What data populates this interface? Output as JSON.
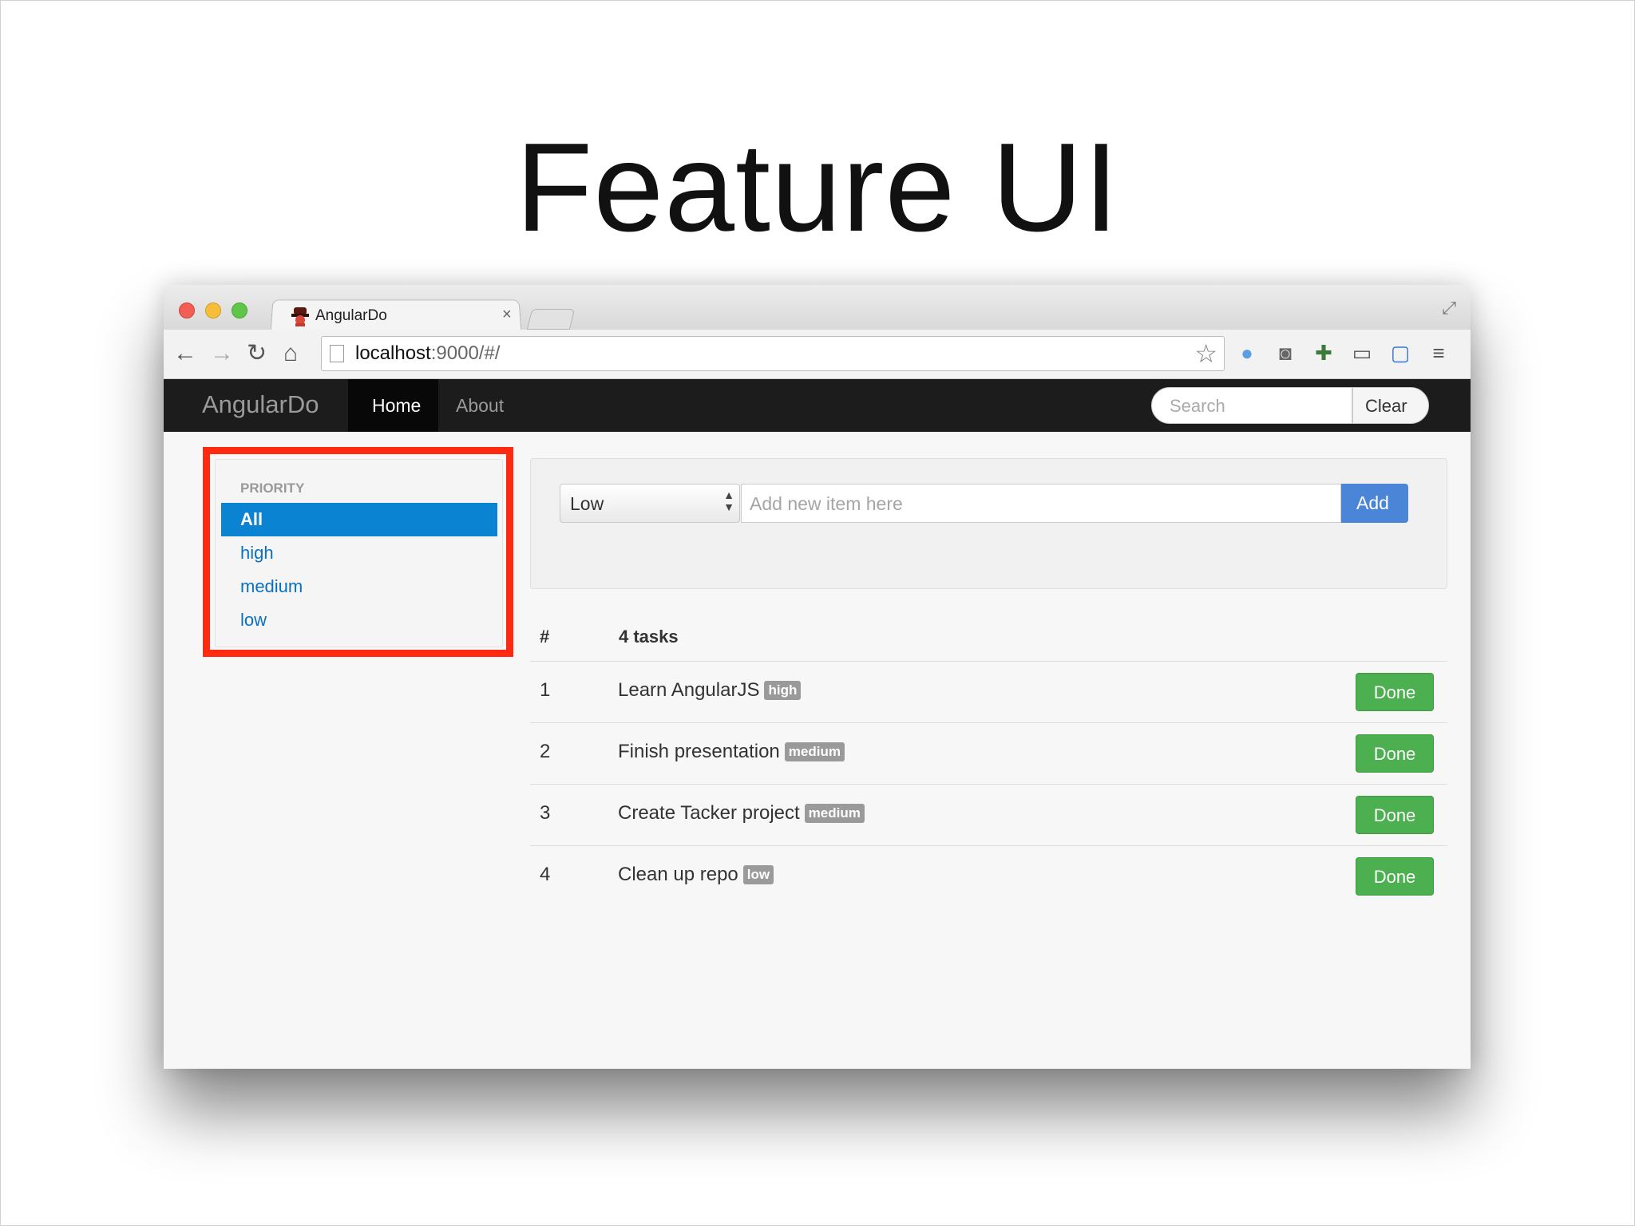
{
  "slide": {
    "title": "Feature UI"
  },
  "browser": {
    "tab_title": "AngularDo",
    "tab_close": "×",
    "url_host": "localhost",
    "url_rest": ":9000/#/"
  },
  "navbar": {
    "brand": "AngularDo",
    "links": [
      {
        "label": "Home",
        "active": true
      },
      {
        "label": "About",
        "active": false
      }
    ],
    "search_placeholder": "Search",
    "clear_label": "Clear"
  },
  "sidebar": {
    "header": "PRIORITY",
    "items": [
      {
        "label": "All",
        "active": true
      },
      {
        "label": "high",
        "active": false
      },
      {
        "label": "medium",
        "active": false
      },
      {
        "label": "low",
        "active": false
      }
    ],
    "highlight_color": "#ff2a10"
  },
  "form": {
    "priority_value": "Low",
    "item_placeholder": "Add new item here",
    "add_label": "Add"
  },
  "tasks": {
    "col_num": "#",
    "col_title": "4 tasks",
    "rows": [
      {
        "num": "1",
        "title": "Learn AngularJS",
        "badge": "high",
        "action": "Done"
      },
      {
        "num": "2",
        "title": "Finish presentation",
        "badge": "medium",
        "action": "Done"
      },
      {
        "num": "3",
        "title": "Create Tacker project",
        "badge": "medium",
        "action": "Done"
      },
      {
        "num": "4",
        "title": "Clean up repo",
        "badge": "low",
        "action": "Done"
      }
    ]
  },
  "colors": {
    "accent": "#0a83d2",
    "done_green": "#4caf50",
    "add_blue": "#4b85d8",
    "navbar_bg": "#1c1c1c"
  }
}
